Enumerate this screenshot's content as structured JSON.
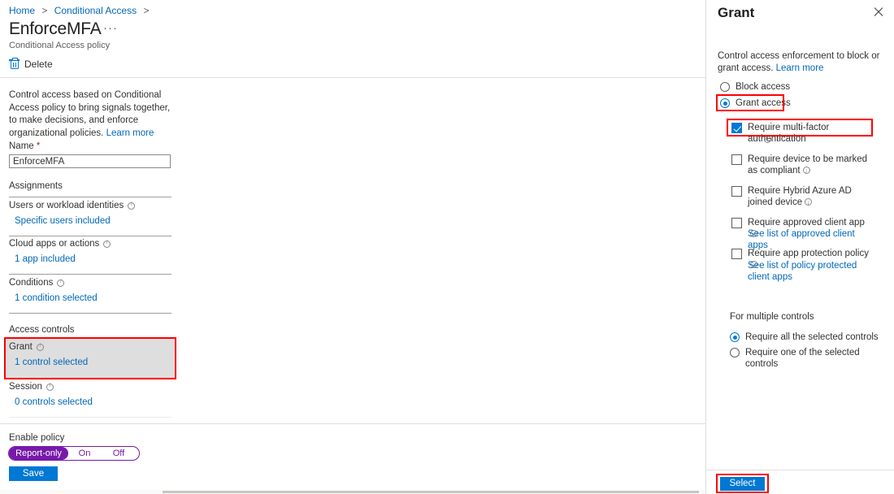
{
  "breadcrumb": {
    "items": [
      "Home",
      "Conditional Access"
    ],
    "separator": ">"
  },
  "header": {
    "title": "EnforceMFA",
    "ellipsis": "···",
    "subtitle": "Conditional Access policy",
    "command_delete": "Delete",
    "delete_icon": "trash-icon"
  },
  "main": {
    "description": "Control access based on Conditional Access policy to bring signals together, to make decisions, and enforce organizational policies.",
    "learn_more": "Learn more",
    "name_label": "Name",
    "name_required_mark": "*",
    "name_value": "EnforceMFA",
    "assignments_heading": "Assignments",
    "assignments": [
      {
        "label": "Users or workload identities",
        "value": "Specific users included",
        "info_icon": "info-icon"
      },
      {
        "label": "Cloud apps or actions",
        "value": "1 app included",
        "info_icon": "info-icon"
      },
      {
        "label": "Conditions",
        "value": "1 condition selected",
        "info_icon": "info-icon"
      }
    ],
    "access_controls_heading": "Access controls",
    "controls": [
      {
        "label": "Grant",
        "value": "1 control selected",
        "info_icon": "info-icon",
        "selected": true,
        "highlighted": true
      },
      {
        "label": "Session",
        "value": "0 controls selected",
        "info_icon": "info-icon",
        "selected": false,
        "highlighted": false
      }
    ],
    "enable_policy_label": "Enable policy",
    "policy_toggle": {
      "options": [
        "Report-only",
        "On",
        "Off"
      ],
      "selected": "Report-only",
      "accent": "#7719aa"
    },
    "save_label": "Save",
    "save_color": "#0078d4"
  },
  "panel": {
    "title": "Grant",
    "close_icon": "close-icon",
    "description": "Control access enforcement to block or grant access.",
    "learn_more": "Learn more",
    "access_mode": {
      "options": [
        {
          "label": "Block access",
          "selected": false,
          "highlighted": false
        },
        {
          "label": "Grant access",
          "selected": true,
          "highlighted": true
        }
      ]
    },
    "grant_controls": [
      {
        "label": "Require multi-factor authentication",
        "checked": true,
        "highlighted": true,
        "info_icon": "info-icon",
        "sublink": null
      },
      {
        "label": "Require device to be marked as compliant",
        "checked": false,
        "highlighted": false,
        "info_icon": "info-icon",
        "sublink": null
      },
      {
        "label": "Require Hybrid Azure AD joined device",
        "checked": false,
        "highlighted": false,
        "info_icon": "info-icon",
        "sublink": null
      },
      {
        "label": "Require approved client app",
        "checked": false,
        "highlighted": false,
        "info_icon": "info-icon",
        "sublink": "See list of approved client apps"
      },
      {
        "label": "Require app protection policy",
        "checked": false,
        "highlighted": false,
        "info_icon": "info-icon",
        "sublink": "See list of policy protected client apps"
      }
    ],
    "multiple_controls_heading": "For multiple controls",
    "multiple_controls": [
      {
        "label": "Require all the selected controls",
        "selected": true
      },
      {
        "label": "Require one of the selected controls",
        "selected": false
      }
    ],
    "select_label": "Select",
    "select_color": "#0078d4",
    "highlight_color": "#ff0000"
  }
}
